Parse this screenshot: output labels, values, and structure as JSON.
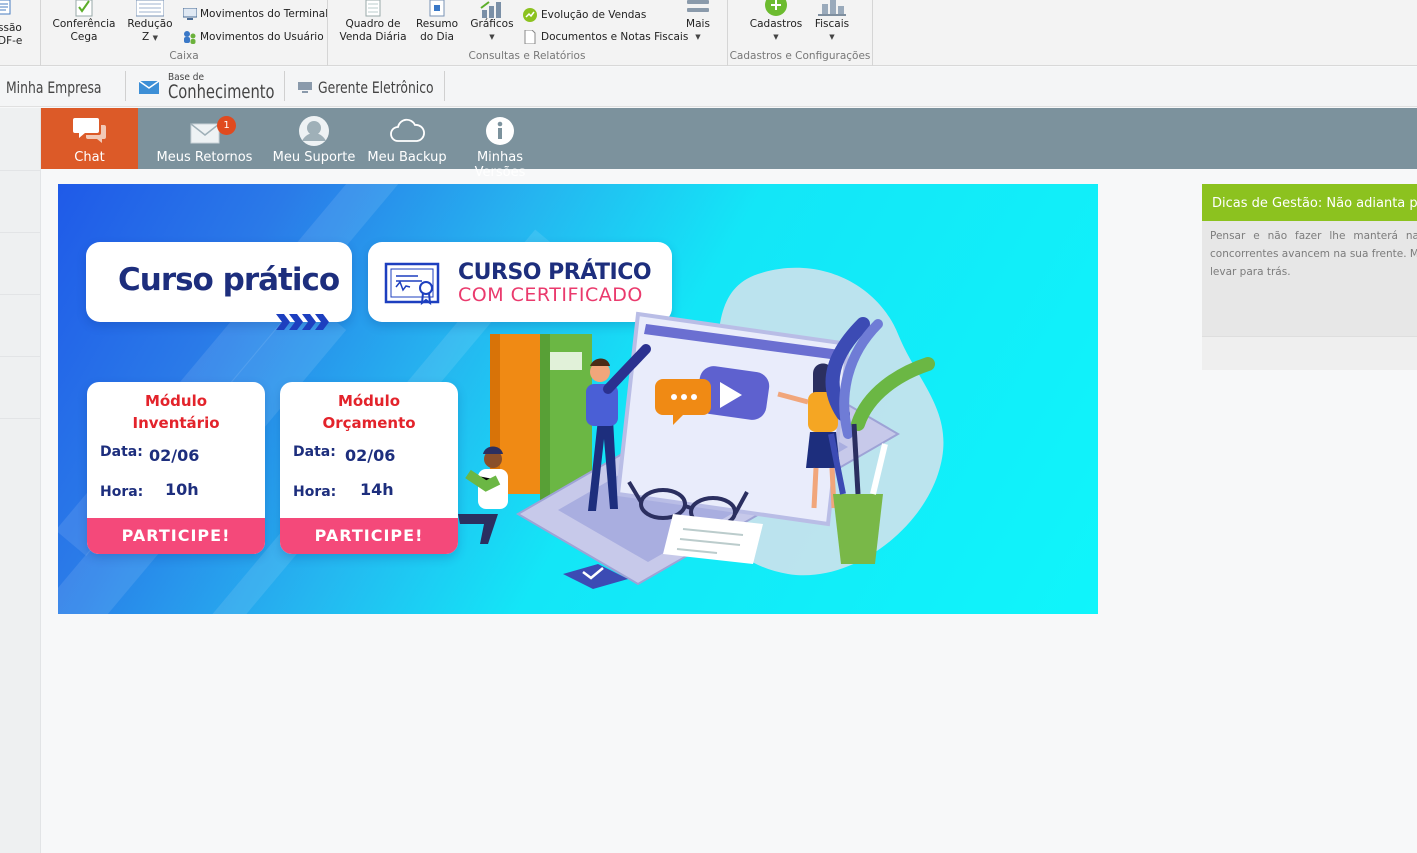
{
  "ribbon": {
    "partial_left_1": "ssão",
    "partial_left_2": "DF-e",
    "conferencia_1": "Conferência",
    "conferencia_2": "Cega",
    "reducao_1": "Redução",
    "reducao_2": "Z",
    "mov_terminal": "Movimentos do Terminal",
    "mov_usuario": "Movimentos do Usuário",
    "group_caixa": "Caixa",
    "quadro_1": "Quadro de",
    "quadro_2": "Venda Diária",
    "resumo_1": "Resumo",
    "resumo_2": "do Dia",
    "graficos": "Gráficos",
    "evolucao": "Evolução de Vendas",
    "documentos": "Documentos e Notas Fiscais",
    "mais": "Mais",
    "group_consultas": "Consultas e Relatórios",
    "cadastros": "Cadastros",
    "fiscais": "Fiscais",
    "group_cadastros": "Cadastros e Configurações"
  },
  "toolbar2": {
    "minha_empresa": "Minha Empresa",
    "base_small": "Base de",
    "base_big": "Conhecimento",
    "gerente": "Gerente Eletrônico"
  },
  "nav": {
    "items": [
      {
        "label": "Chat",
        "icon": "chat-bubbles-icon"
      },
      {
        "label": "Meus Retornos",
        "icon": "envelope-icon",
        "badge": "1"
      },
      {
        "label": "Meu Suporte",
        "icon": "user-icon"
      },
      {
        "label": "Meu Backup",
        "icon": "cloud-icon"
      },
      {
        "label": "Minhas Versões",
        "icon": "info-icon"
      }
    ],
    "active_color": "#dc5a28",
    "bar_color": "#7c929d"
  },
  "banner": {
    "title": "Curso prático",
    "cert_line1": "CURSO PRÁTICO",
    "cert_line2": "COM CERTIFICADO",
    "modules": [
      {
        "line1": "Módulo",
        "line2": "Inventário",
        "data_label": "Data:",
        "data": "02/06",
        "hora_label": "Hora:",
        "hora": "10h",
        "cta": "PARTICIPE!"
      },
      {
        "line1": "Módulo",
        "line2": "Orçamento",
        "data_label": "Data:",
        "data": "02/06",
        "hora_label": "Hora:",
        "hora": "14h",
        "cta": "PARTICIPE!"
      }
    ]
  },
  "tips": {
    "header": "Dicas de Gestão: Não adianta per",
    "body": "Pensar e não fazer lhe manterá na concorrentes avancem na sua frente. M levar para trás.",
    "header_color": "#8cc21f"
  }
}
